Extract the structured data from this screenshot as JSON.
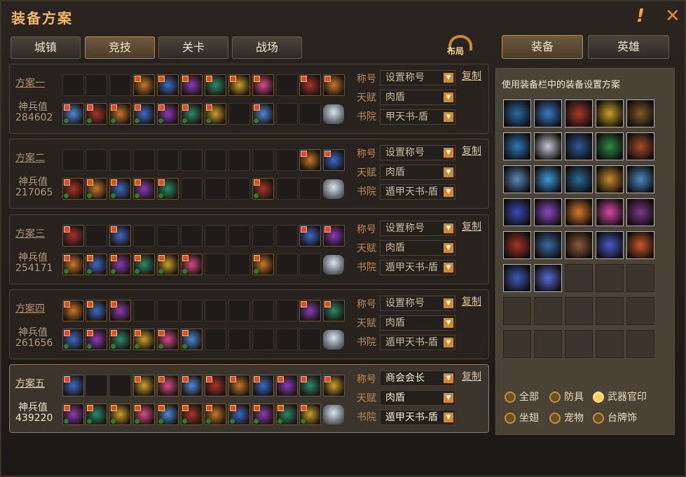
{
  "window": {
    "title": "装备方案"
  },
  "tabs": [
    {
      "label": "城镇",
      "active": false
    },
    {
      "label": "竞技",
      "active": true
    },
    {
      "label": "关卡",
      "active": false
    },
    {
      "label": "战场",
      "active": false
    }
  ],
  "layout_button": {
    "label": "布局"
  },
  "right_tabs": [
    {
      "label": "装备",
      "active": true
    },
    {
      "label": "英雄",
      "active": false
    }
  ],
  "labels": {
    "title_label": "称号",
    "talent_label": "天赋",
    "school_label": "书院",
    "power_label": "神兵值",
    "copy_label": "复制"
  },
  "plans": [
    {
      "name": "方案一",
      "power": "284602",
      "title_value": "设置称号",
      "talent_value": "肉盾",
      "school_value": "甲天书-盾",
      "active": false,
      "row1": [
        0,
        0,
        0,
        1,
        1,
        1,
        1,
        1,
        1,
        0,
        1,
        1
      ],
      "row2": [
        1,
        1,
        1,
        1,
        1,
        1,
        1,
        0,
        1,
        0,
        0
      ]
    },
    {
      "name": "方案二",
      "power": "217065",
      "title_value": "设置称号",
      "talent_value": "肉盾",
      "school_value": "遁甲天书-盾",
      "active": false,
      "row1": [
        0,
        0,
        0,
        0,
        0,
        0,
        0,
        0,
        0,
        0,
        1,
        1
      ],
      "row2": [
        1,
        1,
        1,
        1,
        1,
        0,
        0,
        0,
        1,
        0,
        0
      ]
    },
    {
      "name": "方案三",
      "power": "254171",
      "title_value": "设置称号",
      "talent_value": "肉盾",
      "school_value": "遁甲天书-盾",
      "active": false,
      "row1": [
        1,
        0,
        1,
        0,
        0,
        0,
        0,
        0,
        0,
        0,
        1,
        1
      ],
      "row2": [
        1,
        1,
        1,
        1,
        1,
        1,
        0,
        0,
        1,
        0,
        0
      ]
    },
    {
      "name": "方案四",
      "power": "261656",
      "title_value": "设置称号",
      "talent_value": "肉盾",
      "school_value": "遁甲天书-盾",
      "active": false,
      "row1": [
        1,
        1,
        1,
        0,
        0,
        0,
        0,
        0,
        0,
        0,
        1,
        1
      ],
      "row2": [
        1,
        1,
        1,
        1,
        1,
        1,
        0,
        0,
        0,
        0,
        0
      ]
    },
    {
      "name": "方案五",
      "power": "439220",
      "title_value": "商会会长",
      "talent_value": "肉盾",
      "school_value": "遁甲天书-盾",
      "active": true,
      "row1": [
        1,
        0,
        0,
        1,
        1,
        1,
        1,
        1,
        1,
        1,
        1,
        1
      ],
      "row2": [
        1,
        1,
        1,
        1,
        1,
        1,
        1,
        1,
        1,
        1,
        1
      ]
    }
  ],
  "inventory": {
    "hint": "使用装备栏中的装备设置方案",
    "filled_count": 27,
    "total_slots": 40,
    "item_colors": [
      "#2a6aa8",
      "#3a7ac8",
      "#a83a2a",
      "#c8a02a",
      "#7a5a2a",
      "#2a7ab8",
      "#c8c8d8",
      "#2a5a98",
      "#2a8a4a",
      "#a84a2a",
      "#5a8ab8",
      "#3a9ad8",
      "#2a6a98",
      "#c88a2a",
      "#4a8ac8",
      "#3a4ab8",
      "#8a4ac8",
      "#d87a2a",
      "#d84aa8",
      "#7a3a8a",
      "#a8342a",
      "#3a6aa8",
      "#8a5a3a",
      "#4a5ac8",
      "#c85a2a",
      "#3a5ab8",
      "#5a6ad8"
    ]
  },
  "filters": [
    {
      "label": "全部",
      "selected": false
    },
    {
      "label": "防具",
      "selected": false
    },
    {
      "label": "武器官印",
      "selected": true
    },
    {
      "label": "坐翅",
      "selected": false
    },
    {
      "label": "宠物",
      "selected": false
    },
    {
      "label": "台牌饰",
      "selected": false
    }
  ],
  "colors": {
    "accent": "#f0b86a",
    "dropdown_arrow": "#d48a2a",
    "slot_badge": "#e44a2a"
  }
}
